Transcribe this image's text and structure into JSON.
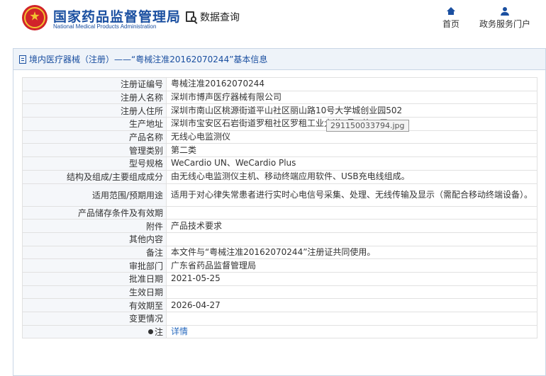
{
  "header": {
    "logo_icon": "national-emblem-icon",
    "brand_cn": "国家药品监督管理局",
    "brand_en": "National Medical Products Administration",
    "data_query_icon": "document-search-icon",
    "data_query_label": "数据查询",
    "nav": [
      {
        "icon": "home-icon",
        "label": "首页"
      },
      {
        "icon": "user-icon",
        "label": "政务服务门户"
      }
    ],
    "brand_color": "#1a4fa0"
  },
  "panel": {
    "title": "境内医疗器械（注册）——“粤械注准20162070244”基本信息",
    "rows": [
      {
        "key": "注册证编号",
        "value": "粤械注准20162070244"
      },
      {
        "key": "注册人名称",
        "value": "深圳市博声医疗器械有限公司"
      },
      {
        "key": "注册人住所",
        "value": "深圳市南山区桃源街道平山社区丽山路10号大学城创业园502"
      },
      {
        "key": "生产地址",
        "value": "深圳市宝安区石岩街道罗租社区罗租工业大道1号M栋二层"
      },
      {
        "key": "产品名称",
        "value": "无线心电监测仪"
      },
      {
        "key": "管理类别",
        "value": "第二类"
      },
      {
        "key": "型号规格",
        "value": "WeCardio UN、WeCardio Plus"
      },
      {
        "key": "结构及组成/主要组成成分",
        "value": "由无线心电监测仪主机、移动终端应用软件、USB充电线组成。"
      },
      {
        "key": "适用范围/预期用途",
        "value": "适用于对心律失常患者进行实时心电信号采集、处理、无线传输及显示（需配合移动终端设备）。"
      },
      {
        "key": "产品储存条件及有效期",
        "value": ""
      },
      {
        "key": "附件",
        "value": "产品技术要求"
      },
      {
        "key": "其他内容",
        "value": ""
      },
      {
        "key": "备注",
        "value": "本文件与“粤械注准20162070244”注册证共同使用。"
      },
      {
        "key": "审批部门",
        "value": "广东省药品监督管理局"
      },
      {
        "key": "批准日期",
        "value": "2021-05-25"
      },
      {
        "key": "生效日期",
        "value": ""
      },
      {
        "key": "有效期至",
        "value": "2026-04-27"
      },
      {
        "key": "变更情况",
        "value": ""
      },
      {
        "key": "注",
        "value": "详情",
        "key_icon": "pin-icon"
      }
    ]
  },
  "tooltip": "291150033794.jpg"
}
